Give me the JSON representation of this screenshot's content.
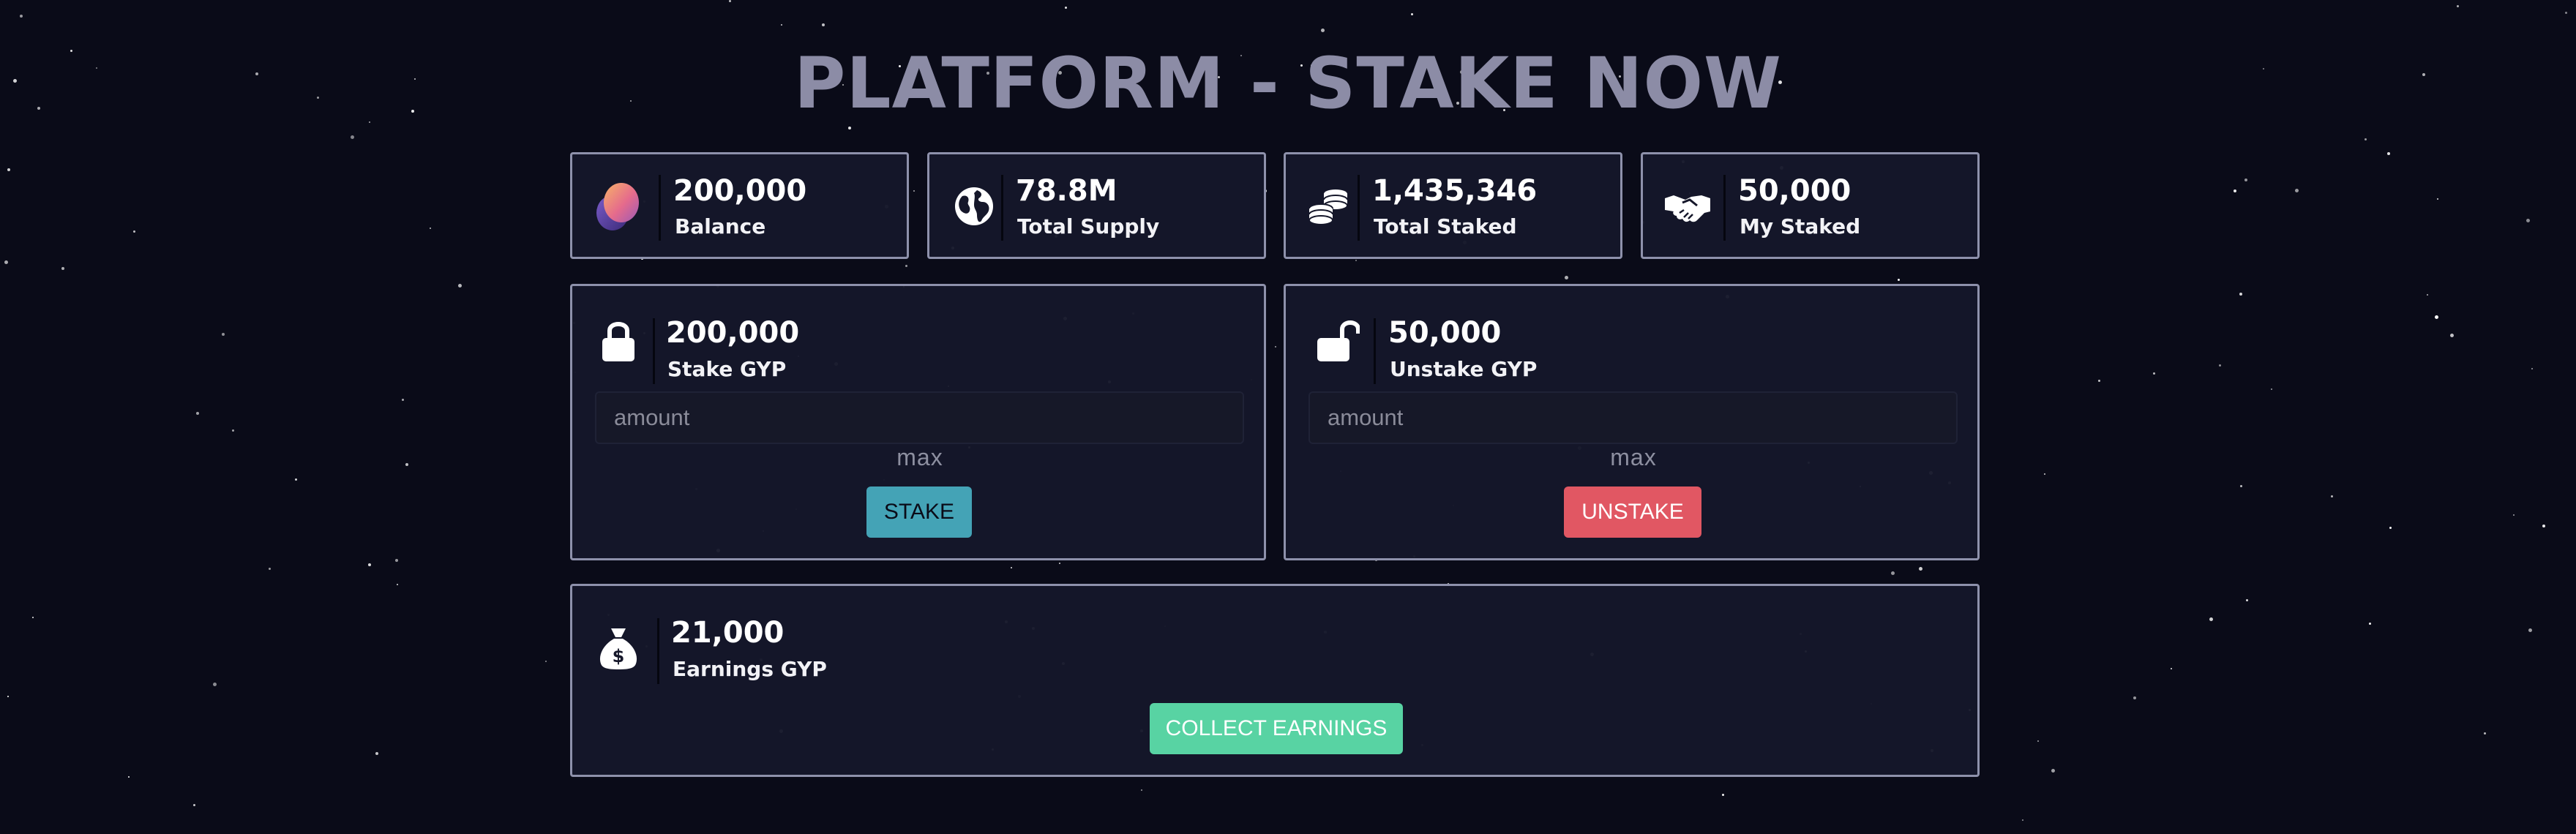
{
  "page": {
    "title": "PLATFORM - STAKE NOW"
  },
  "stats": [
    {
      "value": "200,000",
      "label": "Balance",
      "icon": "token-logo-icon"
    },
    {
      "value": "78.8M",
      "label": "Total Supply",
      "icon": "globe-icon"
    },
    {
      "value": "1,435,346",
      "label": "Total Staked",
      "icon": "coins-icon"
    },
    {
      "value": "50,000",
      "label": "My Staked",
      "icon": "handshake-icon"
    }
  ],
  "stake": {
    "value": "200,000",
    "label": "Stake GYP",
    "icon": "lock-icon",
    "placeholder": "amount",
    "max_label": "max",
    "button_label": "STAKE",
    "button_color": "#44a3b6"
  },
  "unstake": {
    "value": "50,000",
    "label": "Unstake GYP",
    "icon": "unlock-icon",
    "placeholder": "amount",
    "max_label": "max",
    "button_label": "UNSTAKE",
    "button_color": "#e15763"
  },
  "earnings": {
    "value": "21,000",
    "label": "Earnings GYP",
    "icon": "money-bag-icon",
    "button_label": "COLLECT EARNINGS",
    "button_color": "#58d3a3"
  },
  "colors": {
    "background": "#0a0b18",
    "card": "#15172a",
    "card_border": "#8e91ab",
    "title": "#8c8ca6"
  }
}
